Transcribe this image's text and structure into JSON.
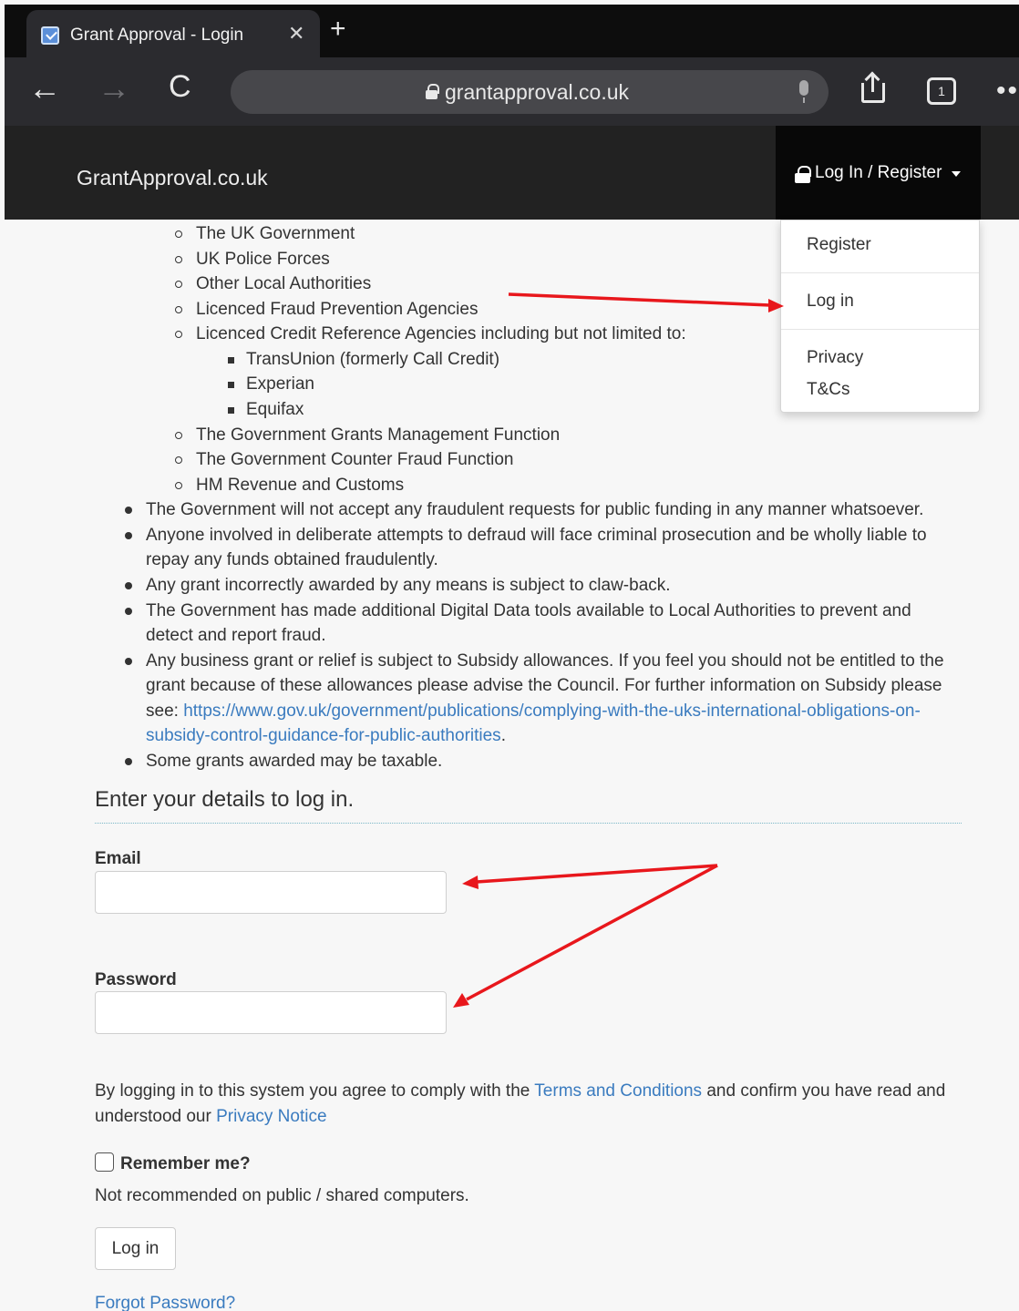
{
  "browser": {
    "tab_title": "Grant Approval - Login",
    "tab_close": "✕",
    "new_tab": "+",
    "url": "grantapproval.co.uk",
    "tab_count": "1",
    "back": "←",
    "forward": "→",
    "reload": "C",
    "more": "••"
  },
  "header": {
    "brand": "GrantApproval.co.uk",
    "login_toggle": "Log In / Register"
  },
  "dropdown": {
    "items": [
      "Register",
      "Log in",
      "Privacy",
      "T&Cs"
    ]
  },
  "content": {
    "sub_items": [
      "The UK Government",
      "UK Police Forces",
      "Other Local Authorities",
      "Licenced Fraud Prevention Agencies",
      "Licenced Credit Reference Agencies including but not limited to:"
    ],
    "agencies": [
      "TransUnion (formerly Call Credit)",
      "Experian",
      "Equifax"
    ],
    "sub_items_2": [
      "The Government Grants Management Function",
      "The Government Counter Fraud Function",
      "HM Revenue and Customs"
    ],
    "bullets": {
      "b1": "The Government will not accept any fraudulent requests for public funding in any manner whatsoever.",
      "b2_l1": "Anyone involved in deliberate attempts to defraud will face criminal prosecution and be wholly liable to",
      "b2_l2": "repay any funds obtained fraudulently.",
      "b3": "Any grant incorrectly awarded by any means is subject to claw-back.",
      "b4_l1": "The Government has made additional Digital Data tools available to Local Authorities to prevent and",
      "b4_l2": "detect and report fraud.",
      "b5_l1": "Any business grant or relief is subject to Subsidy allowances. If you feel you should not be entitled to the",
      "b5_l2": "grant because of these allowances please advise the Council. For further information on Subsidy please",
      "b5_l3_prefix": "see: ",
      "b5_link_l1": "https://www.gov.uk/government/publications/complying-with-the-uks-international-obligations-on-",
      "b5_link_l2": "subsidy-control-guidance-for-public-authorities",
      "b5_end": ".",
      "b6": "Some grants awarded may be taxable."
    }
  },
  "login_form": {
    "heading": "Enter your details to log in.",
    "email_label": "Email",
    "email_value": "",
    "password_label": "Password",
    "password_value": "",
    "agree_l1_prefix": "By logging in to this system you agree to comply with the ",
    "terms_link": "Terms and Conditions",
    "agree_l1_suffix": " and confirm you have read and",
    "agree_l2_prefix": "understood our ",
    "privacy_link": "Privacy Notice",
    "remember_label": "Remember me?",
    "remember_note": "Not recommended on public / shared computers.",
    "submit": "Log in",
    "forgot": "Forgot Password?"
  },
  "colors": {
    "annotation_arrow": "#e8171c",
    "link": "#3a7bbf",
    "header_bg": "#222222"
  }
}
